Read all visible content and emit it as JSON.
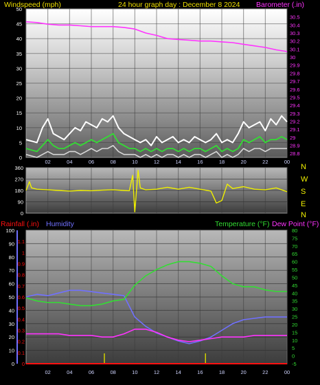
{
  "header": {
    "left": "Windspeed (mph)",
    "center": "24 hour graph day : December 8 2024",
    "right": "Barometer (.in)"
  },
  "colors": {
    "label": "#f0e000",
    "barometer": "#ff33ff",
    "wind_gust": "#ffffff",
    "wind_avg": "#33dd33",
    "wind_min": "#d8d8d8",
    "direction": "#f0f000",
    "rainfall": "#ff1010",
    "humidity": "#7070ff",
    "temperature": "#33dd33",
    "dewpoint": "#ff33ff",
    "rain_tick": "#d0d000"
  },
  "chart_data": [
    {
      "id": "wind-barometer",
      "type": "line",
      "x_labels": [
        "02",
        "04",
        "06",
        "08",
        "10",
        "12",
        "14",
        "16",
        "18",
        "20",
        "22",
        "00"
      ],
      "xlim": [
        0,
        24
      ],
      "ylabel_left": "Windspeed (mph)",
      "ylim_left": [
        0,
        50
      ],
      "y_ticks_left": [
        "0",
        "5",
        "10",
        "15",
        "20",
        "25",
        "30",
        "35",
        "40",
        "45",
        "50"
      ],
      "ylabel_right": "Barometer (.in)",
      "ylim_right": [
        28.75,
        30.6
      ],
      "y_ticks_right": [
        "28.8",
        "28.9",
        "29",
        "29.1",
        "29.2",
        "29.3",
        "29.4",
        "29.5",
        "29.6",
        "29.7",
        "29.8",
        "29.9",
        "30",
        "30.1",
        "30.2",
        "30.3",
        "30.4",
        "30.5"
      ],
      "series": [
        {
          "name": "Barometer (.in)",
          "axis": "right",
          "x": [
            0,
            1,
            2,
            3,
            4,
            5,
            6,
            7,
            8,
            9,
            10,
            11,
            12,
            13,
            14,
            15,
            16,
            17,
            18,
            19,
            20,
            21,
            22,
            23,
            24
          ],
          "values": [
            30.44,
            30.43,
            30.41,
            30.4,
            30.4,
            30.39,
            30.38,
            30.38,
            30.38,
            30.37,
            30.35,
            30.3,
            30.27,
            30.23,
            30.22,
            30.21,
            30.2,
            30.2,
            30.19,
            30.18,
            30.16,
            30.14,
            30.12,
            30.09,
            30.07
          ]
        },
        {
          "axis": "left",
          "x": [
            0,
            1,
            1.5,
            2,
            2.5,
            3,
            3.5,
            4,
            4.5,
            5,
            5.5,
            6,
            6.5,
            7,
            7.5,
            8,
            8.5,
            9,
            9.5,
            10,
            10.5,
            11,
            11.5,
            12,
            12.5,
            13,
            13.5,
            14,
            14.5,
            15,
            15.5,
            16,
            16.5,
            17,
            17.5,
            18,
            18.5,
            19,
            19.5,
            20,
            20.5,
            21,
            21.5,
            22,
            22.5,
            23,
            23.5,
            24
          ],
          "values": [
            6,
            5,
            10,
            13,
            8,
            7,
            6,
            8,
            10,
            9,
            12,
            11,
            10,
            13,
            12,
            14,
            10,
            8,
            7,
            6,
            5,
            6,
            4,
            7,
            5,
            6,
            7,
            5,
            6,
            5,
            7,
            6,
            5,
            6,
            8,
            5,
            6,
            5,
            8,
            12,
            10,
            11,
            12,
            9,
            13,
            11,
            14,
            12
          ]
        },
        {
          "axis": "left",
          "x": [
            0,
            1,
            1.5,
            2,
            2.5,
            3,
            3.5,
            4,
            4.5,
            5,
            5.5,
            6,
            6.5,
            7,
            7.5,
            8,
            8.5,
            9,
            9.5,
            10,
            10.5,
            11,
            11.5,
            12,
            12.5,
            13,
            13.5,
            14,
            14.5,
            15,
            15.5,
            16,
            16.5,
            17,
            17.5,
            18,
            18.5,
            19,
            19.5,
            20,
            20.5,
            21,
            21.5,
            22,
            22.5,
            23,
            23.5,
            24
          ],
          "values": [
            3,
            2,
            4,
            6,
            4,
            3,
            3,
            4,
            5,
            4,
            5,
            6,
            5,
            6,
            7,
            8,
            5,
            4,
            3,
            3,
            2,
            3,
            2,
            3,
            2,
            3,
            3,
            2,
            3,
            2,
            3,
            3,
            2,
            3,
            4,
            2,
            3,
            2,
            3,
            6,
            5,
            6,
            7,
            5,
            6,
            6,
            7,
            6
          ]
        },
        {
          "axis": "left",
          "x": [
            0,
            1,
            1.5,
            2,
            2.5,
            3,
            3.5,
            4,
            4.5,
            5,
            5.5,
            6,
            6.5,
            7,
            7.5,
            8,
            8.5,
            9,
            9.5,
            10,
            10.5,
            11,
            11.5,
            12,
            12.5,
            13,
            13.5,
            14,
            14.5,
            15,
            15.5,
            16,
            16.5,
            17,
            17.5,
            18,
            18.5,
            19,
            19.5,
            20,
            20.5,
            21,
            21.5,
            22,
            22.5,
            23,
            23.5,
            24
          ],
          "values": [
            1,
            0,
            1,
            2,
            1,
            1,
            1,
            2,
            2,
            1,
            2,
            3,
            2,
            3,
            3,
            4,
            2,
            1,
            1,
            1,
            0,
            1,
            0,
            1,
            0,
            1,
            1,
            0,
            1,
            0,
            1,
            1,
            0,
            1,
            2,
            0,
            1,
            0,
            1,
            3,
            2,
            3,
            3,
            2,
            3,
            3,
            3,
            3
          ]
        }
      ]
    },
    {
      "id": "wind-direction",
      "type": "line",
      "xlim": [
        0,
        24
      ],
      "ylim": [
        0,
        360
      ],
      "y_ticks": [
        "0",
        "90",
        "180",
        "270",
        "360"
      ],
      "compass": [
        "N",
        "W",
        "S",
        "E",
        "N"
      ],
      "series": [
        {
          "axis": "left",
          "x": [
            0,
            0.3,
            0.5,
            1,
            2,
            3,
            4,
            5,
            6,
            7,
            8,
            9,
            9.5,
            9.8,
            10,
            10.3,
            10.5,
            11,
            12,
            13,
            14,
            15,
            16,
            17,
            17.5,
            18,
            18.5,
            19,
            20,
            21,
            22,
            23,
            24
          ],
          "values": [
            180,
            250,
            200,
            190,
            185,
            180,
            175,
            180,
            178,
            182,
            185,
            180,
            178,
            300,
            10,
            340,
            200,
            185,
            190,
            205,
            190,
            205,
            190,
            175,
            80,
            100,
            230,
            195,
            210,
            190,
            185,
            200,
            170
          ]
        }
      ]
    },
    {
      "id": "rain-humidity-temp",
      "type": "line",
      "x_labels": [
        "02",
        "04",
        "06",
        "08",
        "10",
        "12",
        "14",
        "16",
        "18",
        "20",
        "22",
        "00"
      ],
      "xlim": [
        0,
        24
      ],
      "ylabel_rainfall": "Rainfall (.in)",
      "ylim_rainfall": [
        0,
        1.2
      ],
      "y_ticks_rainfall": [
        "0",
        "0.1",
        "0.2",
        "0.3",
        "0.4",
        "0.5",
        "0.6",
        "0.7",
        "0.8",
        "0.9",
        "1",
        "1.1"
      ],
      "ylabel_humidity": "Humidity",
      "ylim_humidity": [
        0,
        100
      ],
      "y_ticks_humidity": [
        "0",
        "10",
        "20",
        "30",
        "40",
        "50",
        "60",
        "70",
        "80",
        "90",
        "100"
      ],
      "ylabel_right": "Temperature (°F)",
      "ylabel_right2": "Dew Point (°F)",
      "ylim_right": [
        -5,
        80
      ],
      "y_ticks_right": [
        "-5",
        "0",
        "5",
        "10",
        "15",
        "20",
        "25",
        "30",
        "35",
        "40",
        "45",
        "50",
        "55",
        "60",
        "65",
        "70",
        "75",
        "80"
      ],
      "series": [
        {
          "name": "Temperature (°F)",
          "axis": "right",
          "x": [
            0,
            1,
            2,
            3,
            4,
            5,
            6,
            7,
            8,
            9,
            10,
            11,
            12,
            13,
            14,
            15,
            16,
            17,
            18,
            19,
            20,
            21,
            22,
            23,
            24
          ],
          "values": [
            37,
            35,
            34,
            34,
            33,
            32,
            32,
            33,
            35,
            36,
            45,
            51,
            55,
            58,
            60,
            60,
            59,
            57,
            51,
            46,
            44,
            44,
            42,
            41,
            41
          ]
        },
        {
          "name": "Dew Point (°F)",
          "axis": "right",
          "x": [
            0,
            1,
            2,
            3,
            4,
            5,
            6,
            7,
            8,
            9,
            10,
            11,
            12,
            13,
            14,
            15,
            16,
            17,
            18,
            19,
            20,
            21,
            22,
            23,
            24
          ],
          "values": [
            14,
            14,
            14,
            14,
            13,
            13,
            13,
            12,
            12,
            14,
            17,
            17,
            15,
            12,
            10,
            9,
            10,
            11,
            12,
            12,
            12,
            13,
            13,
            13,
            13
          ]
        },
        {
          "name": "Humidity",
          "axis": "humidity",
          "x": [
            0,
            1,
            2,
            3,
            4,
            5,
            6,
            7,
            8,
            9,
            10,
            11,
            12,
            13,
            14,
            15,
            16,
            17,
            18,
            19,
            20,
            21,
            22,
            23,
            24
          ],
          "values": [
            50,
            52,
            51,
            53,
            55,
            55,
            54,
            53,
            52,
            51,
            35,
            28,
            23,
            20,
            17,
            15,
            17,
            20,
            25,
            30,
            33,
            34,
            35,
            35,
            35
          ]
        },
        {
          "name": "Rainfall (.in)",
          "axis": "rainfall",
          "x": [
            0,
            24
          ],
          "values": [
            0,
            0
          ]
        }
      ]
    }
  ]
}
